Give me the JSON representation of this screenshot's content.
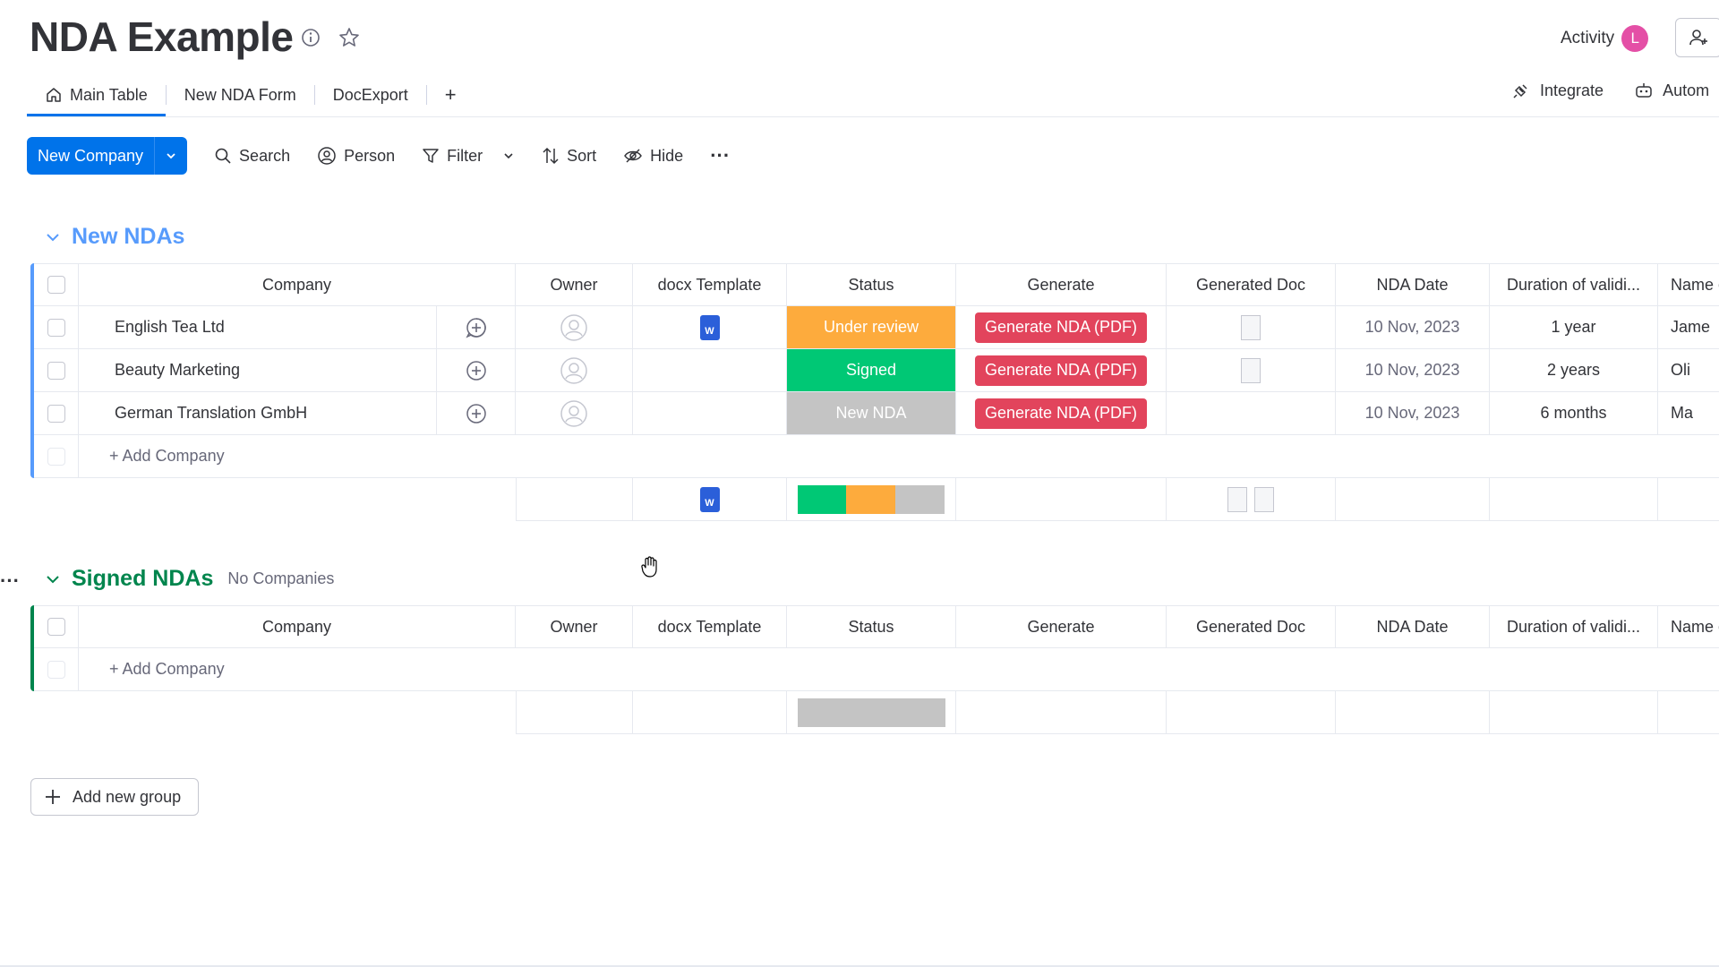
{
  "header": {
    "title": "NDA Example",
    "activity_label": "Activity",
    "avatar_initial": "L"
  },
  "tabs": [
    {
      "label": "Main Table",
      "active": true
    },
    {
      "label": "New NDA Form"
    },
    {
      "label": "DocExport"
    },
    {
      "label": "+"
    }
  ],
  "right_tabs": {
    "integrate": "Integrate",
    "automate": "Autom"
  },
  "toolbar": {
    "new_item": "New Company",
    "search": "Search",
    "person": "Person",
    "filter": "Filter",
    "sort": "Sort",
    "hide": "Hide",
    "more": "···"
  },
  "columns": [
    "Company",
    "Owner",
    "docx Template",
    "Status",
    "Generate",
    "Generated Doc",
    "NDA Date",
    "Duration of validi...",
    "Name c"
  ],
  "groups": [
    {
      "title": "New NDAs",
      "subtitle": "",
      "color": "#579bfc",
      "rows": [
        {
          "company": "English Tea Ltd",
          "status": "Under review",
          "status_color": "#fdab3d",
          "generate": "Generate NDA (PDF)",
          "date": "10 Nov, 2023",
          "duration": "1 year",
          "name": "Jame",
          "has_docx": true,
          "has_doc": true
        },
        {
          "company": "Beauty Marketing",
          "status": "Signed",
          "status_color": "#00c875",
          "generate": "Generate NDA (PDF)",
          "date": "10 Nov, 2023",
          "duration": "2 years",
          "name": "Oli",
          "has_docx": false,
          "has_doc": true
        },
        {
          "company": "German Translation GmbH",
          "status": "New NDA",
          "status_color": "#c4c4c4",
          "generate": "Generate NDA (PDF)",
          "date": "10 Nov, 2023",
          "duration": "6 months",
          "name": "Ma",
          "has_docx": false,
          "has_doc": false
        }
      ],
      "add_label": "+ Add Company",
      "summary_status": [
        {
          "color": "#00c875",
          "share": 0.333
        },
        {
          "color": "#fdab3d",
          "share": 0.333
        },
        {
          "color": "#c4c4c4",
          "share": 0.334
        }
      ]
    },
    {
      "title": "Signed NDAs",
      "subtitle": "No Companies",
      "color": "#00854d",
      "rows": [],
      "add_label": "+ Add Company",
      "summary_status": [
        {
          "color": "#c4c4c4",
          "share": 1
        }
      ]
    }
  ],
  "add_group": "Add new group",
  "word_badge": "W"
}
